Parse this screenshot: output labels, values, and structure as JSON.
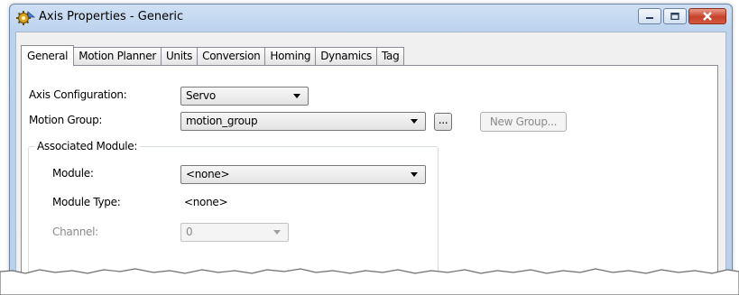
{
  "window": {
    "title": "Axis Properties - Generic",
    "icons": {
      "app": "axis-gear-icon",
      "minimize": "minimize-icon",
      "maximize": "maximize-icon",
      "close": "close-icon"
    }
  },
  "tabs": [
    {
      "label": "General",
      "active": true
    },
    {
      "label": "Motion Planner"
    },
    {
      "label": "Units"
    },
    {
      "label": "Conversion"
    },
    {
      "label": "Homing"
    },
    {
      "label": "Dynamics"
    },
    {
      "label": "Tag"
    }
  ],
  "general": {
    "axis_configuration": {
      "label": "Axis Configuration:",
      "value": "Servo"
    },
    "motion_group": {
      "label": "Motion Group:",
      "value": "motion_group",
      "browse_label": "...",
      "new_group_label": "New Group..."
    },
    "associated_module": {
      "legend": "Associated Module:",
      "module": {
        "label": "Module:",
        "value": "<none>"
      },
      "module_type": {
        "label": "Module Type:",
        "value": "<none>"
      },
      "channel": {
        "label": "Channel:",
        "value": "0"
      }
    }
  },
  "colors": {
    "title_bar": "#bcd3ee",
    "close_button": "#c7412a",
    "panel": "#ffffff"
  }
}
